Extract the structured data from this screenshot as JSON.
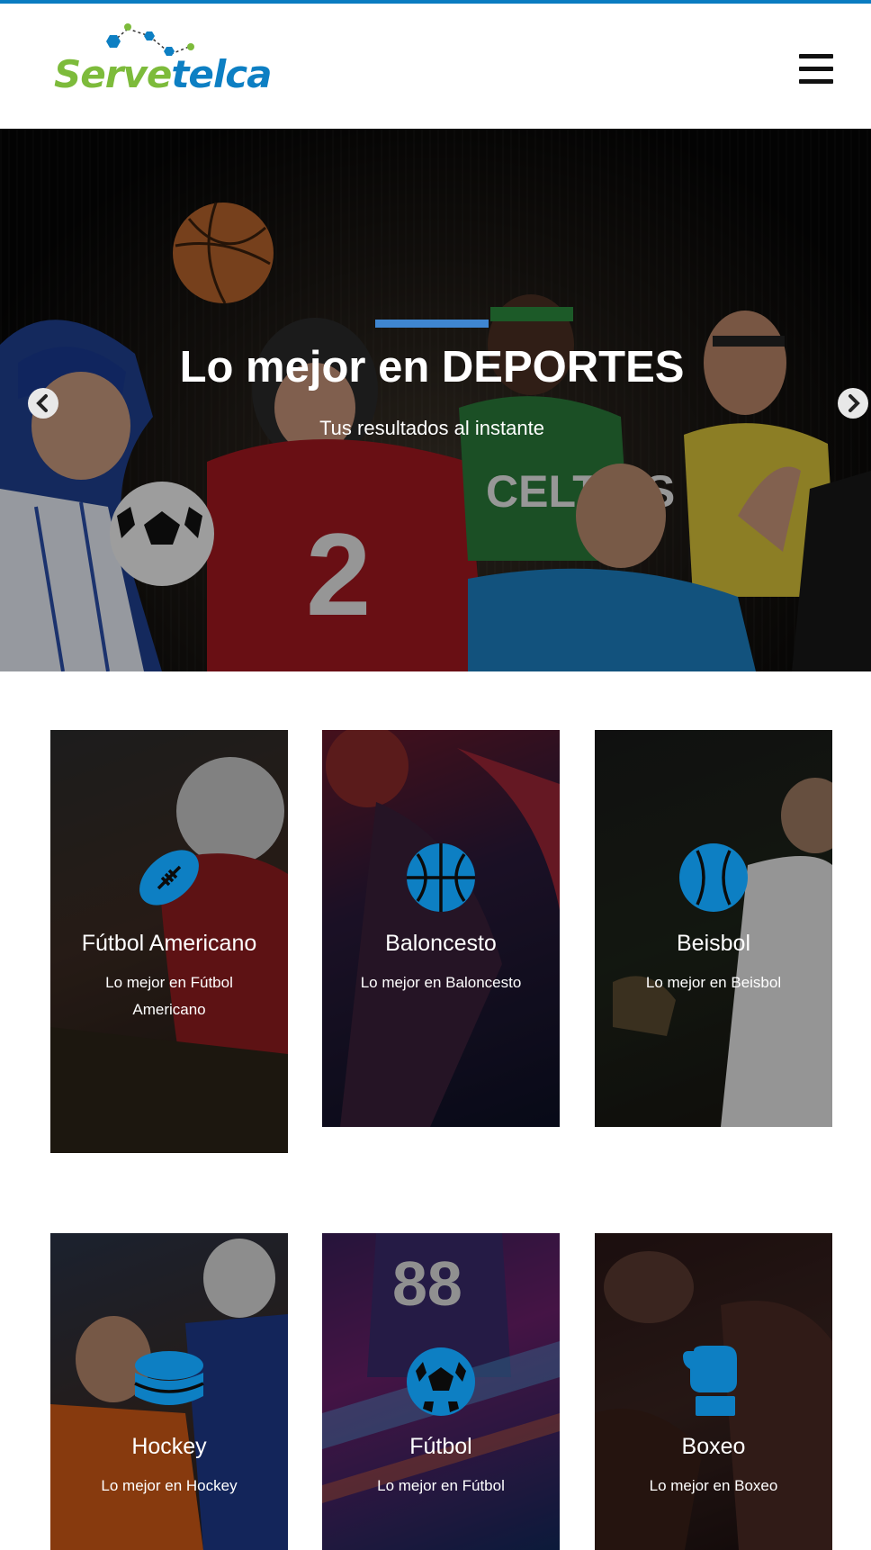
{
  "brand": {
    "name_part1": "Serve",
    "name_part2": "telca",
    "colors": {
      "green": "#7dbb3b",
      "blue": "#0d7fc3",
      "accent": "#3f86d1"
    }
  },
  "header": {
    "menu_icon": "hamburger-icon"
  },
  "hero": {
    "title": "Lo mejor en DEPORTES",
    "subtitle": "Tus resultados al instante",
    "prev_icon": "chevron-left-icon",
    "next_icon": "chevron-right-icon"
  },
  "cards": [
    {
      "title": "Fútbol Americano",
      "desc": "Lo mejor en Fútbol Americano",
      "icon": "football-icon"
    },
    {
      "title": "Baloncesto",
      "desc": "Lo mejor en Baloncesto",
      "icon": "basketball-icon"
    },
    {
      "title": "Beisbol",
      "desc": "Lo mejor en Beisbol",
      "icon": "baseball-icon"
    },
    {
      "title": "Hockey",
      "desc": "Lo mejor en Hockey",
      "icon": "hockey-puck-icon"
    },
    {
      "title": "Fútbol",
      "desc": "Lo mejor en Fútbol",
      "icon": "soccer-ball-icon"
    },
    {
      "title": "Boxeo",
      "desc": "Lo mejor en Boxeo",
      "icon": "boxing-glove-icon"
    }
  ]
}
